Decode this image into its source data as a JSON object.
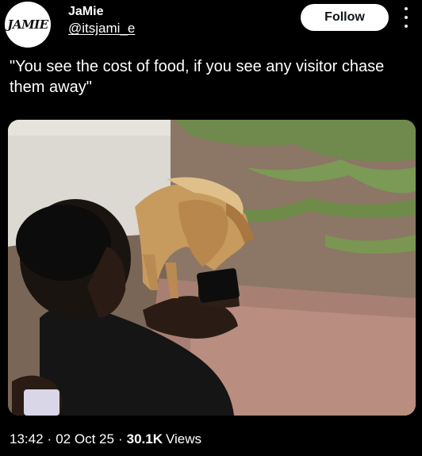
{
  "author": {
    "avatar_text": "JAMIE",
    "display_name": "JaMie",
    "handle": "@itsjami_e"
  },
  "follow_button": {
    "label": "Follow"
  },
  "more_icon": "more-vertical-icon",
  "post": {
    "text": "\"You see the cost of food, if you see any visitor chase them away\""
  },
  "meta": {
    "time": "13:42",
    "separator": "·",
    "date": "02 Oct 25",
    "views_count": "30.1K",
    "views_label": "Views"
  },
  "colors": {
    "background": "#000000",
    "text": "#ffffff",
    "follow_bg": "#ffffff",
    "follow_text": "#0f1419"
  }
}
